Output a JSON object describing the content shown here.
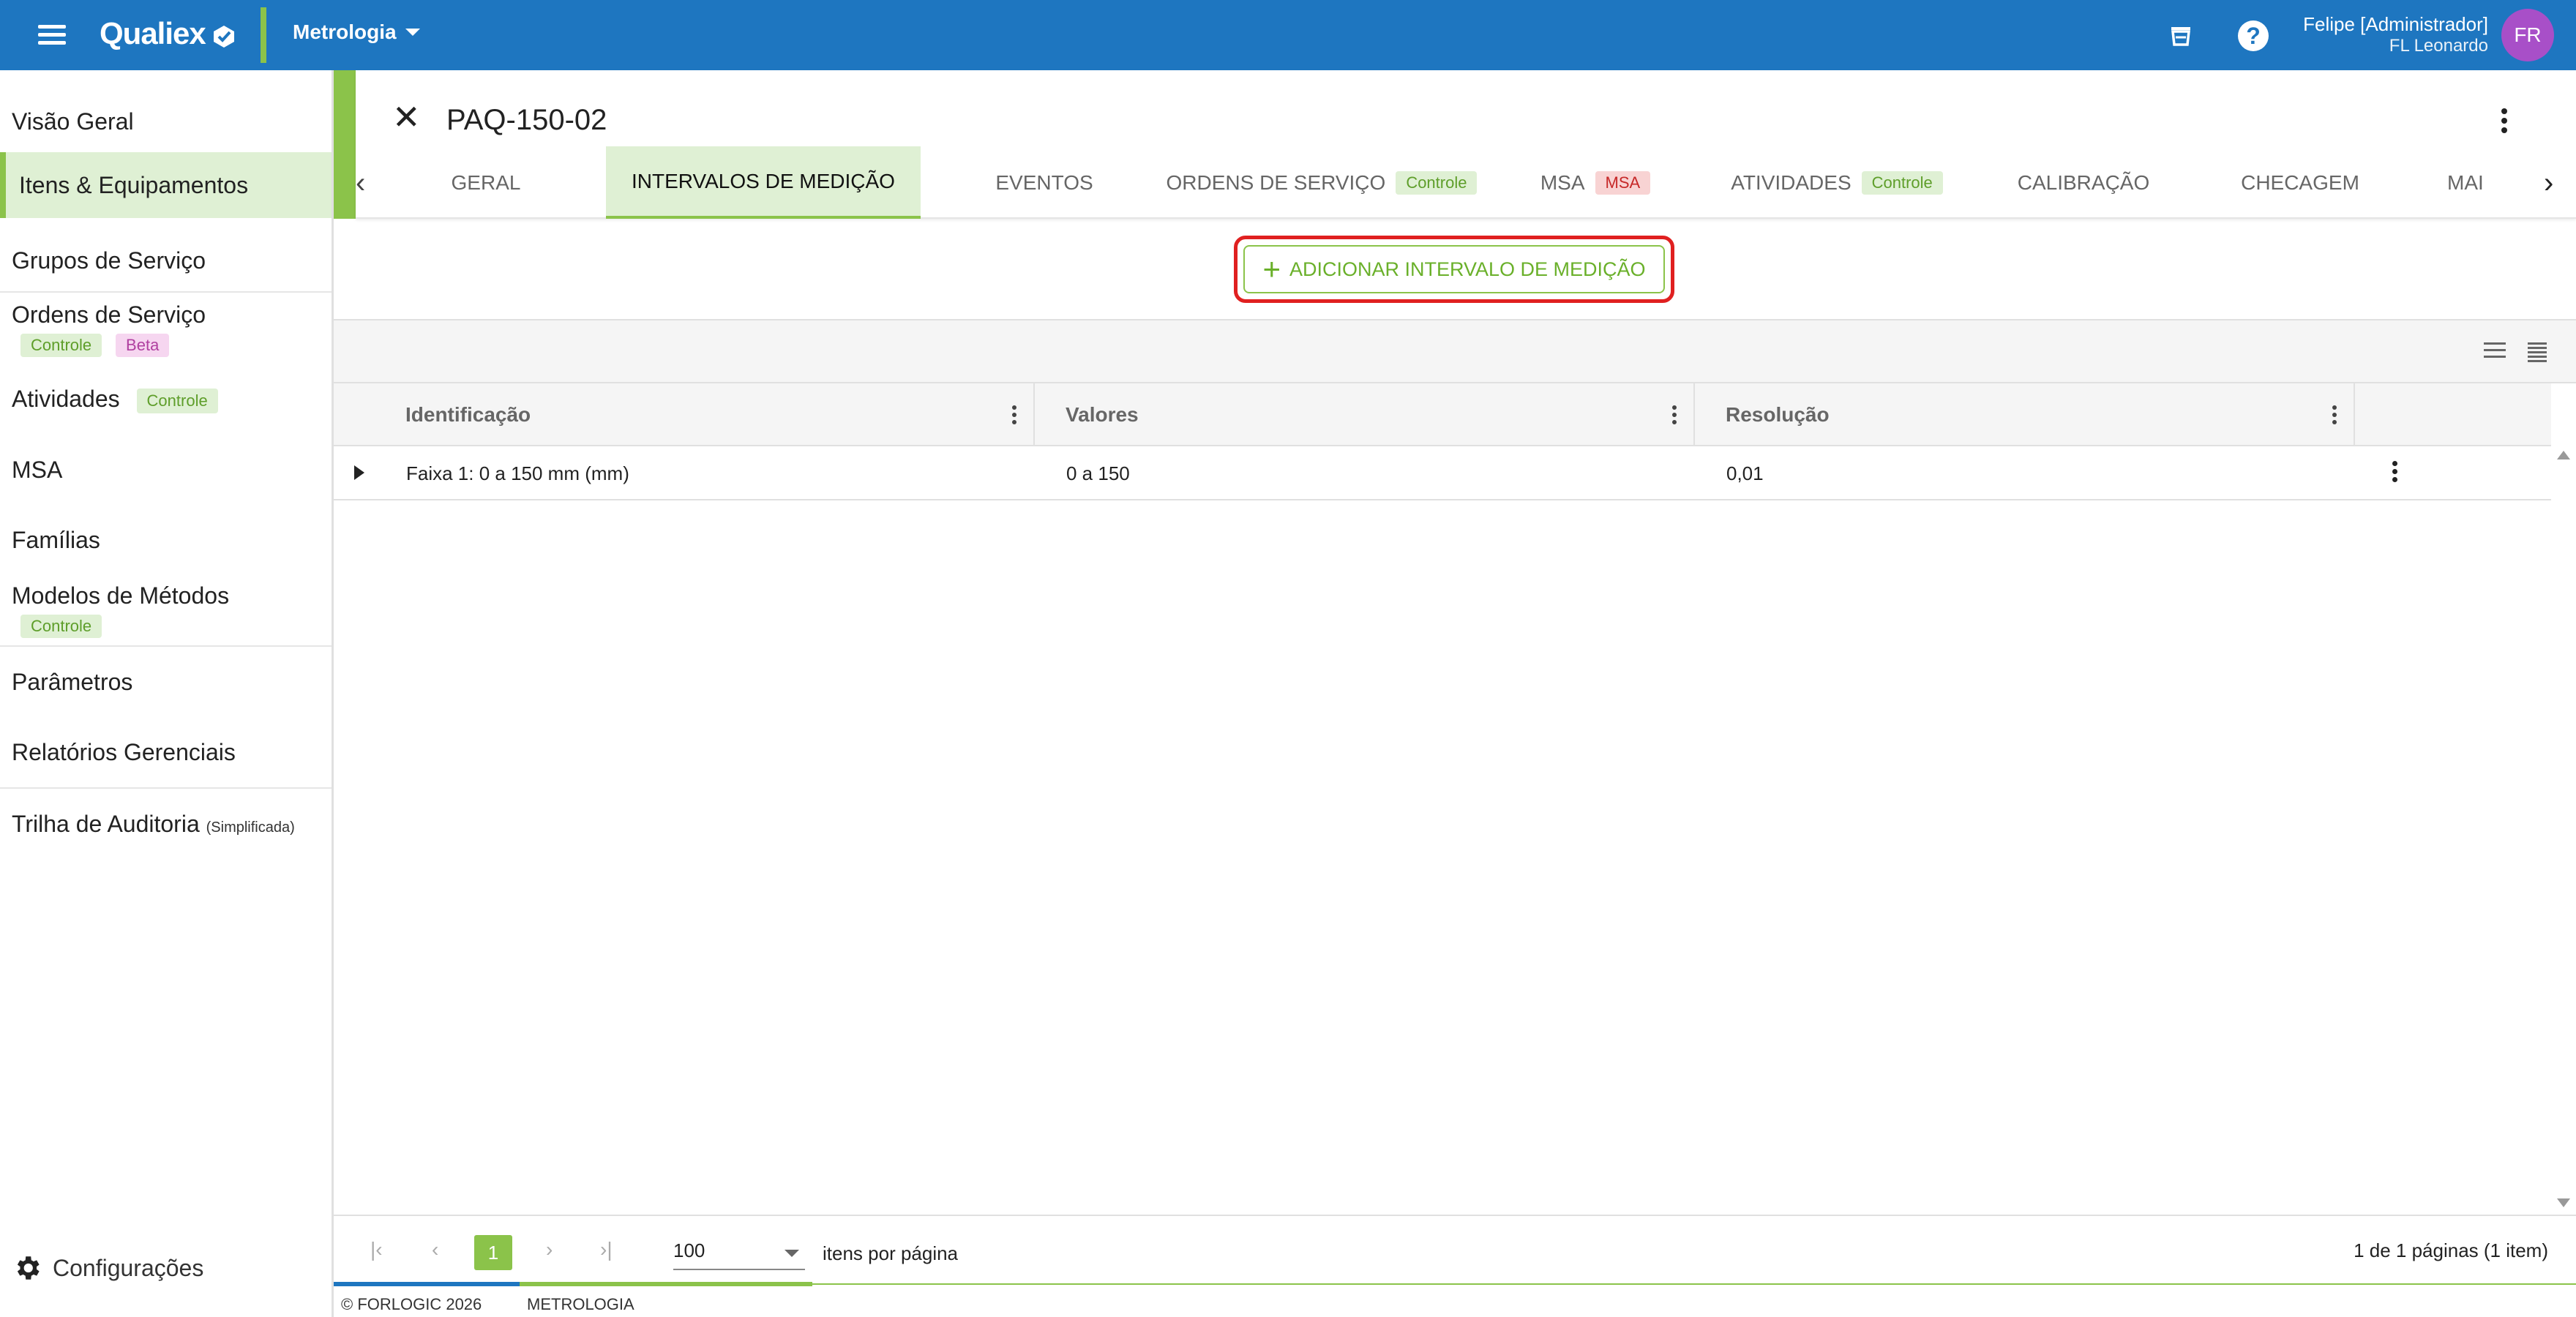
{
  "app": {
    "logo": "Qualiex",
    "module": "Metrologia",
    "user_name": "Felipe [Administrador]",
    "user_org": "FL Leonardo",
    "avatar_initials": "FR",
    "brand_color": "#1e76c0",
    "accent_color": "#8bc34a"
  },
  "sidebar": {
    "items": [
      {
        "label": "Visão Geral"
      },
      {
        "label": "Itens & Equipamentos",
        "active": true
      },
      {
        "label": "Grupos de Serviço"
      },
      {
        "label": "Ordens de Serviço",
        "badges": [
          "Controle",
          "Beta"
        ]
      },
      {
        "label": "Atividades",
        "badges": [
          "Controle"
        ]
      },
      {
        "label": "MSA"
      },
      {
        "label": "Famílias"
      },
      {
        "label": "Modelos de Métodos",
        "badges": [
          "Controle"
        ]
      },
      {
        "label": "Parâmetros"
      },
      {
        "label": "Relatórios Gerenciais"
      },
      {
        "label": "Trilha de Auditoria",
        "suffix": "(Simplificada)"
      }
    ],
    "settings_label": "Configurações"
  },
  "detail": {
    "title": "PAQ-150-02",
    "tabs": [
      {
        "label": "GERAL"
      },
      {
        "label": "INTERVALOS DE MEDIÇÃO",
        "active": true
      },
      {
        "label": "EVENTOS"
      },
      {
        "label": "ORDENS DE SERVIÇO",
        "badge": "Controle"
      },
      {
        "label": "MSA",
        "badge": "MSA"
      },
      {
        "label": "ATIVIDADES",
        "badge": "Controle"
      },
      {
        "label": "CALIBRAÇÃO"
      },
      {
        "label": "CHECAGEM"
      },
      {
        "label": "MAI"
      }
    ],
    "add_button_label": "ADICIONAR INTERVALO DE MEDIÇÃO"
  },
  "table": {
    "columns": [
      "Identificação",
      "Valores",
      "Resolução"
    ],
    "rows": [
      {
        "identificacao": "Faixa 1: 0 a 150 mm (mm)",
        "valores": "0 a 150",
        "resolucao": "0,01"
      }
    ]
  },
  "pager": {
    "current_page": "1",
    "page_size": "100",
    "page_size_label": "itens por página",
    "info": "1 de 1 páginas (1 item)"
  },
  "footer": {
    "copyright": "© FORLOGIC 2026",
    "module": "METROLOGIA"
  }
}
